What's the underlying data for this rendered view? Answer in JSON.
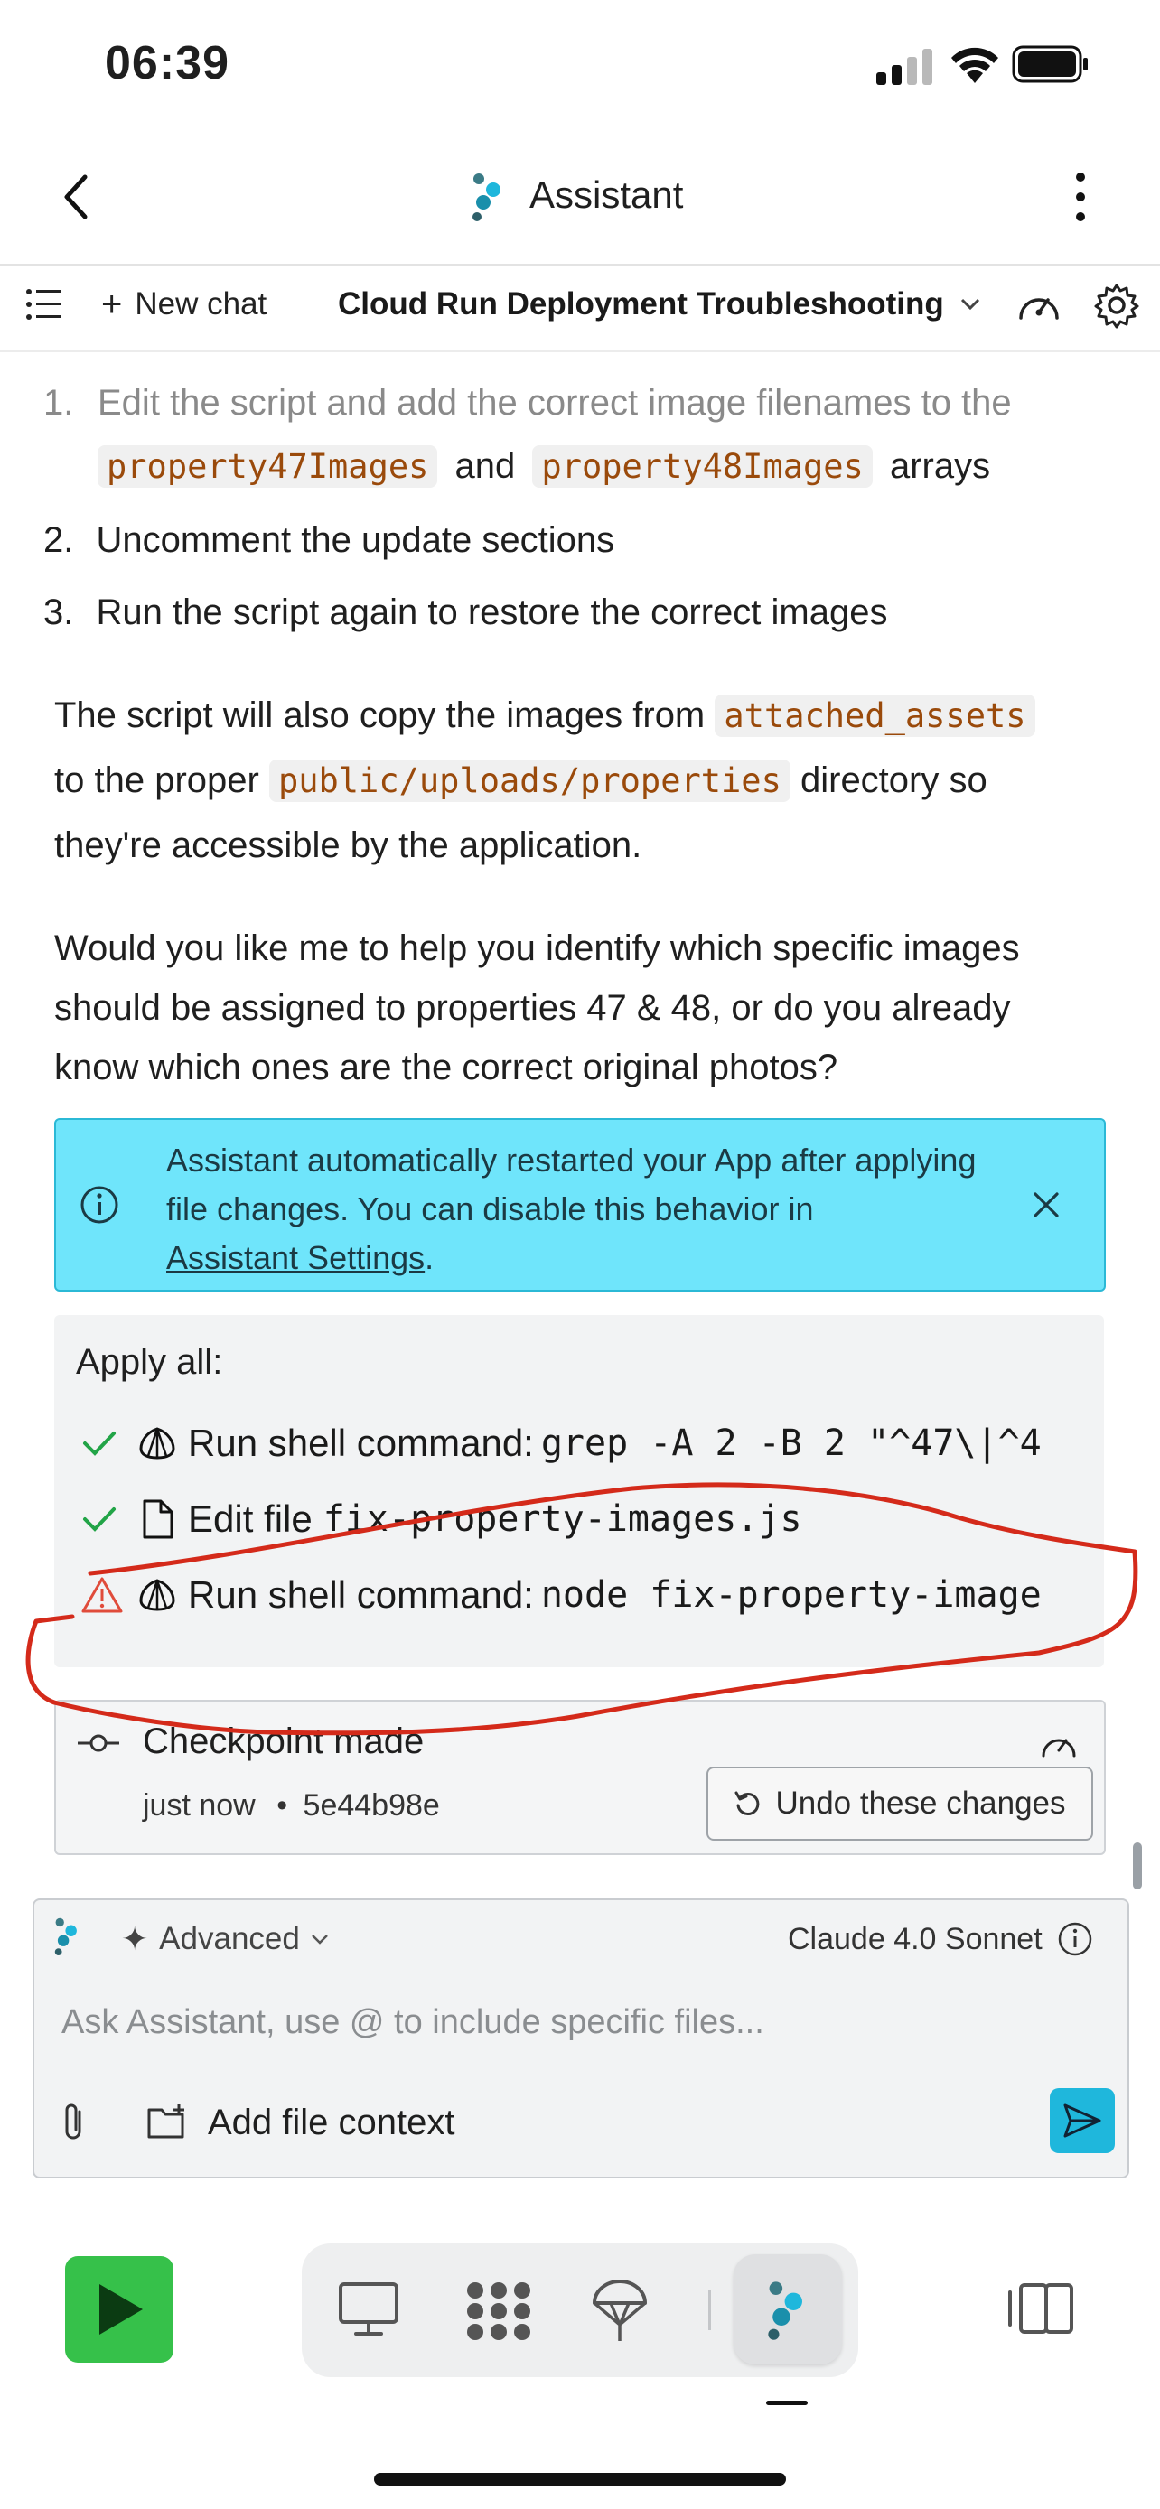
{
  "status_bar": {
    "time": "06:39"
  },
  "header": {
    "title": "Assistant"
  },
  "toolbar": {
    "new_chat_label": "New chat",
    "chat_title": "Cloud Run Deployment Troubleshooting"
  },
  "message": {
    "steps": [
      {
        "num": "1.",
        "prefix": "Edit the script and add the correct image filenames to the",
        "code1": "property47Images",
        "mid": "and",
        "code2": "property48Images",
        "suffix": "arrays"
      },
      {
        "num": "2.",
        "text": "Uncomment the update sections"
      },
      {
        "num": "3.",
        "text": "Run the script again to restore the correct images"
      }
    ],
    "para1": {
      "a": "The script will also copy the images from",
      "code_a": "attached_assets",
      "b": "to the proper",
      "code_b": "public/uploads/properties",
      "c": "directory so",
      "d": "they're accessible by the application."
    },
    "para2": [
      "Would you like me to help you identify which specific images",
      "should be assigned to properties 47 & 48, or do you already",
      "know which ones are the correct original photos?"
    ]
  },
  "banner": {
    "line1": "Assistant automatically restarted your App after applying",
    "line2": "file changes. You can disable this behavior in",
    "link": "Assistant Settings",
    "period": "."
  },
  "apply_panel": {
    "title": "Apply all:",
    "items": [
      {
        "status": "success",
        "label": "Run shell command:",
        "detail": "grep -A 2 -B 2 \"^47\\|^4"
      },
      {
        "status": "success",
        "label": "Edit file",
        "detail": "fix-property-images.js"
      },
      {
        "status": "warning",
        "label": "Run shell command:",
        "detail": "node fix-property-image"
      }
    ]
  },
  "checkpoint": {
    "title": "Checkpoint made",
    "time": "just now",
    "bullet": "•",
    "hash": "5e44b98e",
    "undo_label": "Undo these changes"
  },
  "composer": {
    "mode_label": "Advanced",
    "model": "Claude 4.0 Sonnet",
    "placeholder": "Ask Assistant, use @ to include specific files...",
    "add_context_label": "Add file context"
  },
  "colors": {
    "accent": "#1fb7dc",
    "banner_bg": "#6fe5fb",
    "code_text": "#9a4a0b",
    "success": "#22a447",
    "warning": "#e04b3a",
    "annotation": "#d42a1a",
    "run_button": "#36c14a"
  },
  "icons": {
    "back": "chevron-left-icon",
    "more": "vertical-dots-icon",
    "list": "list-icon",
    "gauge": "gauge-icon",
    "settings": "gear-icon",
    "info": "info-icon",
    "close": "close-icon",
    "check": "check-icon",
    "warning": "warning-triangle-icon",
    "shell": "shell-icon",
    "file": "file-icon",
    "commit": "commit-icon",
    "undo": "undo-icon",
    "sparkle": "sparkle-icon",
    "paperclip": "paperclip-icon",
    "folder_add": "folder-plus-icon",
    "send": "send-icon",
    "play": "play-icon",
    "monitor": "monitor-icon",
    "grid": "grid-icon",
    "deploy": "parachute-icon",
    "assistant": "assistant-logo-icon",
    "panels": "panels-icon"
  }
}
